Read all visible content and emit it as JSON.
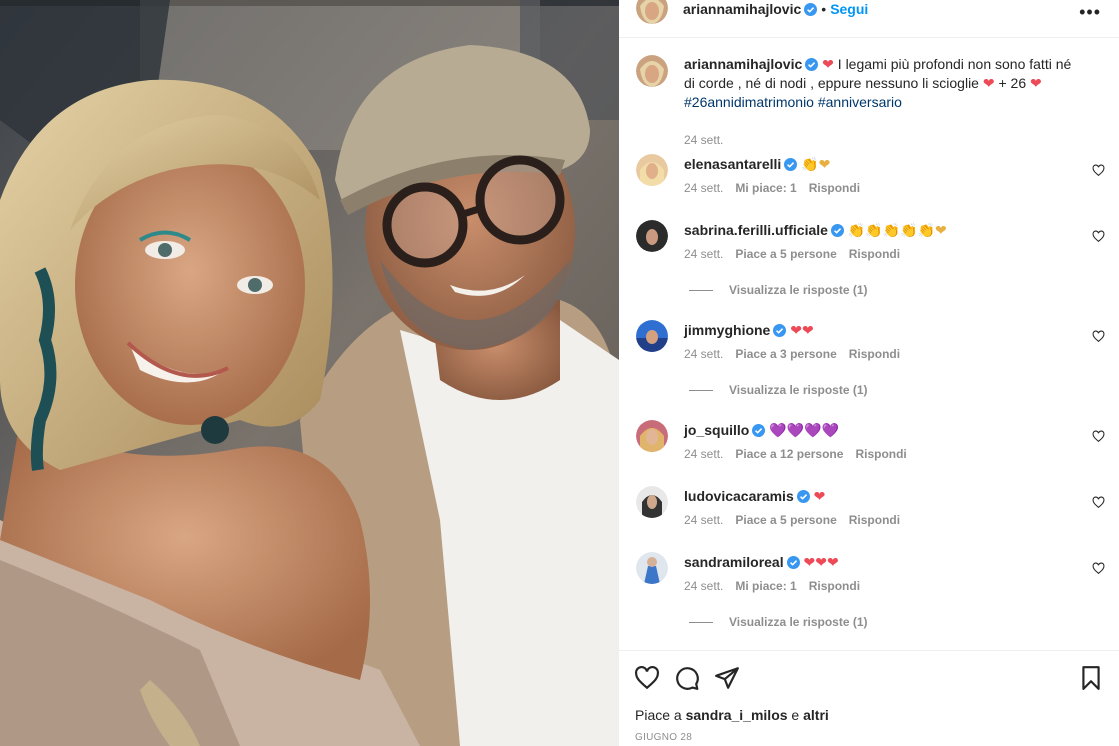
{
  "post": {
    "author": "ariannamihajlovic",
    "follow_label": "Segui",
    "dot": "•",
    "more_label": "•••",
    "caption": {
      "text_before": "I legami più profondi non sono fatti né di corde , né di nodi , eppure nessuno li scioglie",
      "text_after": "+ 26",
      "hashtags": [
        "#26annidimatrimonio",
        "#anniversario"
      ],
      "time": "24 sett."
    },
    "likes_prefix": "Piace a",
    "likes_user": "sandra_i_milos",
    "likes_suffix": "e",
    "likes_others": "altri",
    "date": "GIUGNO 28"
  },
  "comments": [
    {
      "user": "elenasantarelli",
      "emojis": "👏❤",
      "time": "24 sett.",
      "likes": "Mi piace: 1",
      "reply": "Rispondi",
      "view_replies": ""
    },
    {
      "user": "sabrina.ferilli.ufficiale",
      "emojis": "👏👏👏👏👏❤",
      "time": "24 sett.",
      "likes": "Piace a 5 persone",
      "reply": "Rispondi",
      "view_replies": "Visualizza le risposte (1)"
    },
    {
      "user": "jimmyghione",
      "emojis": "❤❤",
      "time": "24 sett.",
      "likes": "Piace a 3 persone",
      "reply": "Rispondi",
      "view_replies": "Visualizza le risposte (1)"
    },
    {
      "user": "jo_squillo",
      "emojis": "💜💜💜💜",
      "time": "24 sett.",
      "likes": "Piace a 12 persone",
      "reply": "Rispondi",
      "view_replies": ""
    },
    {
      "user": "ludovicacaramis",
      "emojis": "❤",
      "time": "24 sett.",
      "likes": "Piace a 5 persone",
      "reply": "Rispondi",
      "view_replies": ""
    },
    {
      "user": "sandramiloreal",
      "emojis": "❤❤❤",
      "time": "24 sett.",
      "likes": "Mi piace: 1",
      "reply": "Rispondi",
      "view_replies": "Visualizza le risposte (1)"
    }
  ],
  "icons": {
    "verified": "verified-badge-icon",
    "like": "heart-icon",
    "comment": "comment-icon",
    "share": "share-icon",
    "save": "bookmark-icon",
    "more": "more-options-icon"
  },
  "colors": {
    "accent_blue": "#0095f6",
    "verified_blue": "#3897f0",
    "heart_red": "#ed4956",
    "muted_text": "#8e8e8e"
  }
}
